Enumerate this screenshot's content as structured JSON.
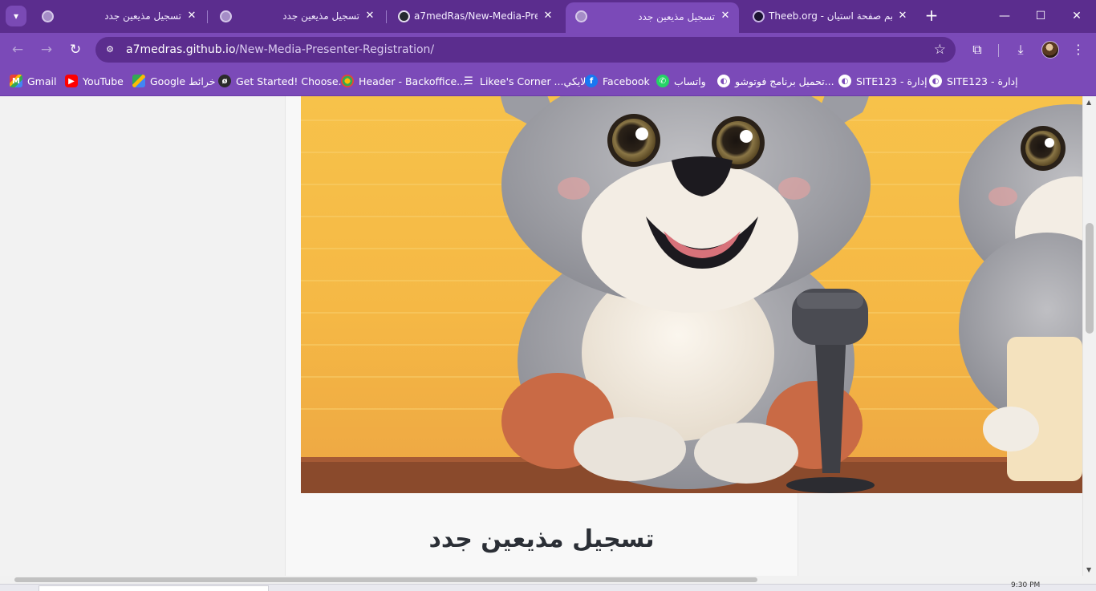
{
  "browser": {
    "tabs": [
      {
        "title": "تسجيل مذيعين جدد",
        "favicon": "globe-icon",
        "active": false
      },
      {
        "title": "تسجيل مذيعين جدد",
        "favicon": "globe-icon",
        "active": false
      },
      {
        "title": "a7medRas/New-Media-Pres",
        "favicon": "github-icon",
        "active": false
      },
      {
        "title": "تسجيل مذيعين جدد",
        "favicon": "globe-icon",
        "active": true
      },
      {
        "title": "Theeb.org - يم صفحة استيان",
        "favicon": "theeb-icon",
        "active": false
      }
    ],
    "close_glyph": "✕",
    "new_tab_glyph": "+",
    "address": {
      "host": "a7medras.github.io",
      "path": "/New-Media-Presenter-Registration/"
    },
    "bookmarks": [
      {
        "label": "Gmail",
        "icon": "gmail-icon",
        "glyph": "M"
      },
      {
        "label": "YouTube",
        "icon": "youtube-icon",
        "glyph": "▶"
      },
      {
        "label": "Google خرائط",
        "icon": "maps-icon",
        "glyph": ""
      },
      {
        "label": "Get Started! Choose...",
        "icon": "getstarted-icon",
        "glyph": "ø"
      },
      {
        "label": "Header - Backoffice...",
        "icon": "header-icon",
        "glyph": ""
      },
      {
        "label": "Likee's Corner ...لايكي",
        "icon": "list-icon",
        "glyph": "☰"
      },
      {
        "label": "Facebook",
        "icon": "facebook-icon",
        "glyph": "f"
      },
      {
        "label": "واتساب",
        "icon": "whatsapp-icon",
        "glyph": "✆"
      },
      {
        "label": "تحميل برنامج فوتوشو...",
        "icon": "globe-icon",
        "glyph": "◐"
      },
      {
        "label": "SITE123 - إدارة",
        "icon": "globe-icon",
        "glyph": "◐"
      },
      {
        "label": "SITE123 - إدارة",
        "icon": "globe-icon",
        "glyph": "◐"
      }
    ]
  },
  "page": {
    "heading": "تسجيل مذيعين جدد",
    "hero_image": "cartoon-wolf-cubs-with-microphone"
  },
  "taskbar": {
    "clock": "9:30 PM"
  }
}
